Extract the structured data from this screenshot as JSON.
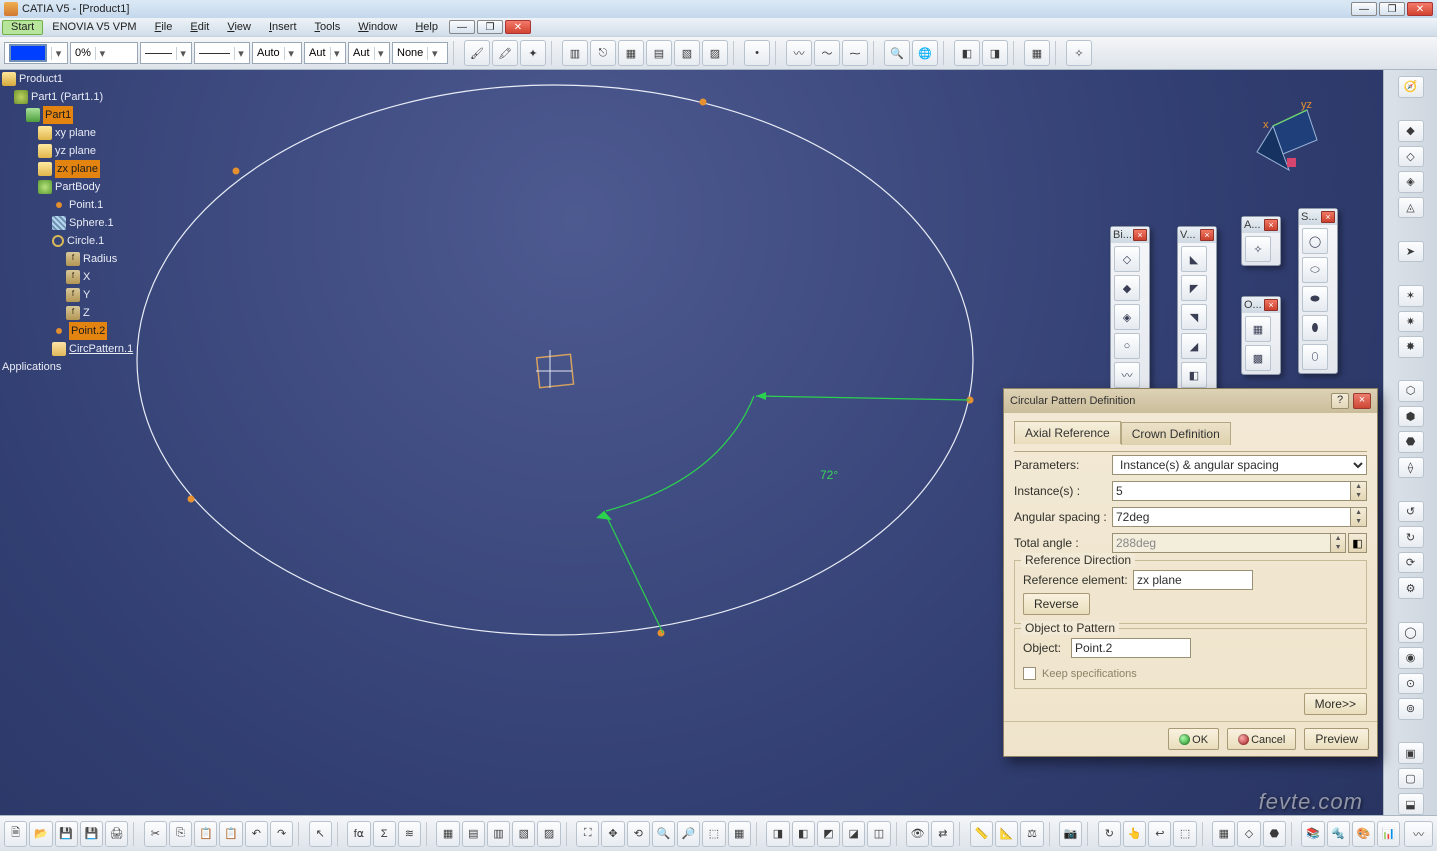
{
  "title": "CATIA V5 - [Product1]",
  "menubar": {
    "start": "Start",
    "items": [
      "ENOVIA V5 VPM",
      "File",
      "Edit",
      "View",
      "Insert",
      "Tools",
      "Window",
      "Help"
    ]
  },
  "topbar": {
    "color": "#003fff",
    "percent_value": "0%",
    "auto1": "Auto",
    "auto2": "Aut",
    "auto3": "Aut",
    "none": "None"
  },
  "tree": {
    "root": "Product1",
    "part_instance": "Part1 (Part1.1)",
    "part": "Part1",
    "planes": [
      "xy plane",
      "yz plane",
      "zx plane"
    ],
    "body": "PartBody",
    "body_children": [
      {
        "label": "Point.1",
        "icon": "pt"
      },
      {
        "label": "Sphere.1",
        "icon": "sph"
      },
      {
        "label": "Circle.1",
        "icon": "circ"
      }
    ],
    "circle_params": [
      "Radius",
      "X",
      "Y",
      "Z"
    ],
    "point2": "Point.2",
    "pattern": "CircPattern.1",
    "apps": "Applications"
  },
  "viewport": {
    "angle_label": "72°",
    "axis_x": "x",
    "axis_yz": "yz"
  },
  "palettes": {
    "bi": "Bi...",
    "v": "V...",
    "a": "A...",
    "o": "O...",
    "s": "S..."
  },
  "dialog": {
    "title": "Circular Pattern Definition",
    "tab_axial": "Axial Reference",
    "tab_crown": "Crown Definition",
    "param_lbl": "Parameters:",
    "param_val": "Instance(s) & angular spacing",
    "inst_lbl": "Instance(s) :",
    "inst_val": "5",
    "ang_lbl": "Angular spacing :",
    "ang_val": "72deg",
    "tot_lbl": "Total angle :",
    "tot_val": "288deg",
    "refdir_title": "Reference Direction",
    "refel_lbl": "Reference element:",
    "refel_val": "zx plane",
    "reverse": "Reverse",
    "obj_title": "Object to Pattern",
    "obj_lbl": "Object:",
    "obj_val": "Point.2",
    "keep": "Keep specifications",
    "more": "More>>",
    "ok": "OK",
    "cancel": "Cancel",
    "preview": "Preview"
  },
  "watermark": "fevte.com"
}
